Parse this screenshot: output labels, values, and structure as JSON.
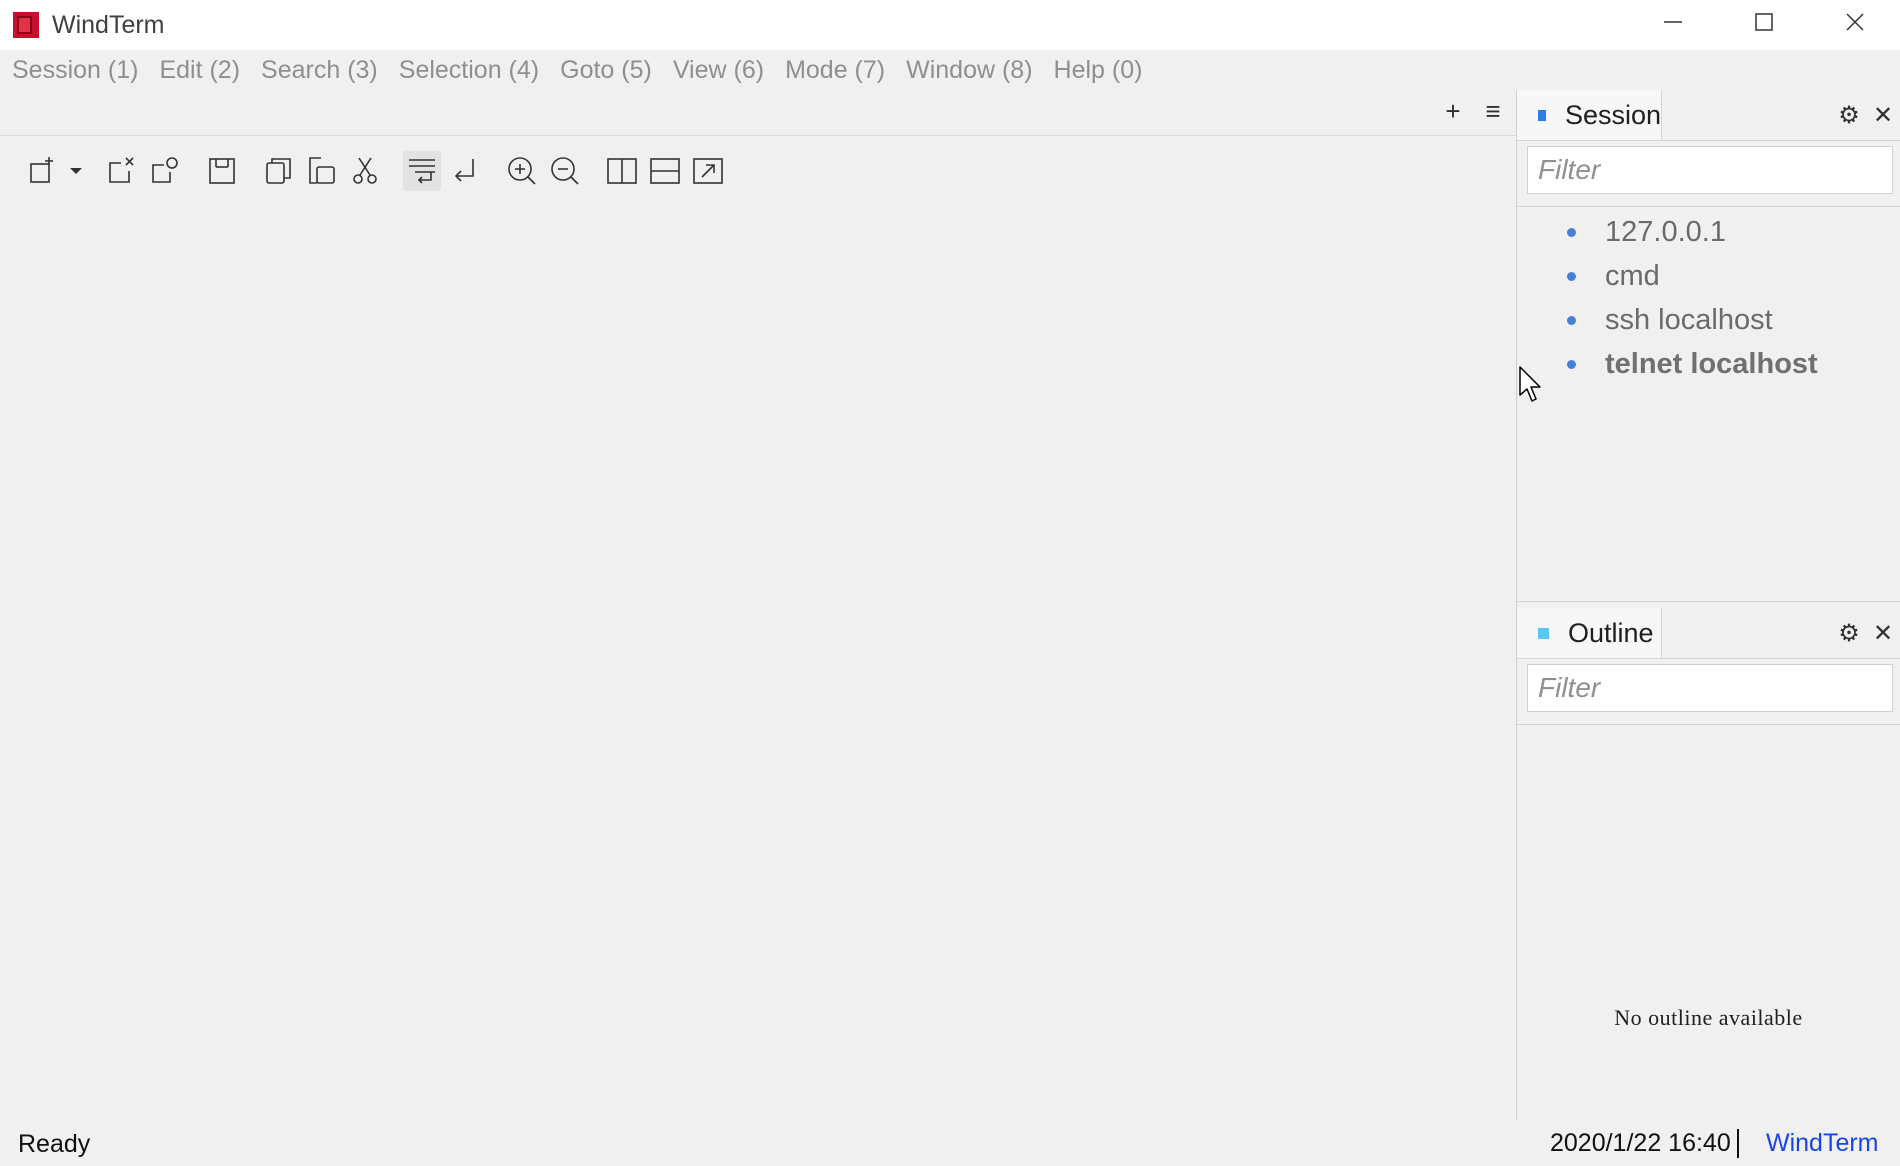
{
  "window": {
    "title": "WindTerm",
    "accent": "#c8102e"
  },
  "menubar": {
    "items": [
      "Session (1)",
      "Edit (2)",
      "Search (3)",
      "Selection (4)",
      "Goto (5)",
      "View (6)",
      "Mode (7)",
      "Window (8)",
      "Help (0)"
    ]
  },
  "tab_actions": {
    "add": "+",
    "menu": "≡"
  },
  "toolbar": {
    "icons": [
      "new-session-icon",
      "dropdown-icon",
      "close-session-icon",
      "reconnect-icon",
      "save-icon",
      "copy-icon",
      "paste-icon",
      "cut-icon",
      "word-wrap-icon",
      "return-icon",
      "zoom-in-icon",
      "zoom-out-icon",
      "split-vertical-icon",
      "split-horizontal-icon",
      "popout-icon"
    ]
  },
  "session_panel": {
    "title": "Session",
    "marker_color": "#2f7ee8",
    "filter_placeholder": "Filter",
    "items": [
      {
        "label": "127.0.0.1",
        "bold": false
      },
      {
        "label": "cmd",
        "bold": false
      },
      {
        "label": "ssh localhost",
        "bold": false
      },
      {
        "label": "telnet localhost",
        "bold": true
      }
    ]
  },
  "outline_panel": {
    "title": "Outline",
    "marker_color": "#5bc6f2",
    "filter_placeholder": "Filter",
    "empty_text": "No outline available"
  },
  "statusbar": {
    "status": "Ready",
    "datetime": "2020/1/22 16:40",
    "app_link": "WindTerm",
    "link_color": "#1a44e6"
  }
}
